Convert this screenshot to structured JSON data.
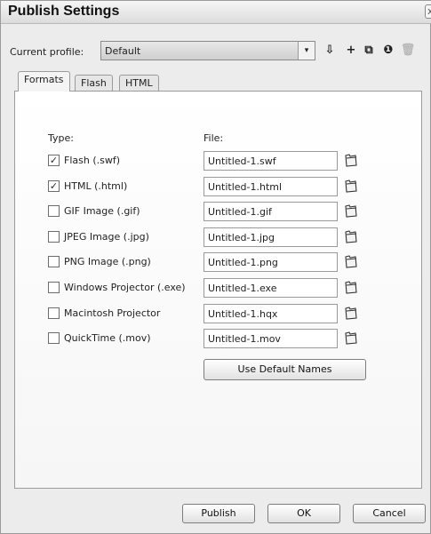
{
  "window": {
    "title": "Publish Settings",
    "close_glyph": "x"
  },
  "profile": {
    "label": "Current profile:",
    "value": "Default",
    "arrow": "▾",
    "tools": [
      {
        "name": "import-export-icon",
        "glyph": "⇩"
      },
      {
        "name": "add-profile-icon",
        "glyph": "+"
      },
      {
        "name": "duplicate-profile-icon",
        "glyph": "⧉"
      },
      {
        "name": "profile-info-icon",
        "glyph": "❶"
      },
      {
        "name": "delete-profile-icon",
        "glyph": "🗑"
      }
    ]
  },
  "tabs": [
    {
      "label": "Formats",
      "active": true
    },
    {
      "label": "Flash",
      "active": false
    },
    {
      "label": "HTML",
      "active": false
    }
  ],
  "formats": {
    "type_header": "Type:",
    "file_header": "File:",
    "rows": [
      {
        "label": "Flash (.swf)",
        "checked": true,
        "file": "Untitled-1.swf"
      },
      {
        "label": "HTML (.html)",
        "checked": true,
        "file": "Untitled-1.html"
      },
      {
        "label": "GIF Image (.gif)",
        "checked": false,
        "file": "Untitled-1.gif"
      },
      {
        "label": "JPEG Image (.jpg)",
        "checked": false,
        "file": "Untitled-1.jpg"
      },
      {
        "label": "PNG Image (.png)",
        "checked": false,
        "file": "Untitled-1.png"
      },
      {
        "label": "Windows Projector (.exe)",
        "checked": false,
        "file": "Untitled-1.exe"
      },
      {
        "label": "Macintosh Projector",
        "checked": false,
        "file": "Untitled-1.hqx"
      },
      {
        "label": "QuickTime (.mov)",
        "checked": false,
        "file": "Untitled-1.mov"
      }
    ],
    "use_default_names": "Use Default Names"
  },
  "footer": {
    "publish": "Publish",
    "ok": "OK",
    "cancel": "Cancel"
  }
}
